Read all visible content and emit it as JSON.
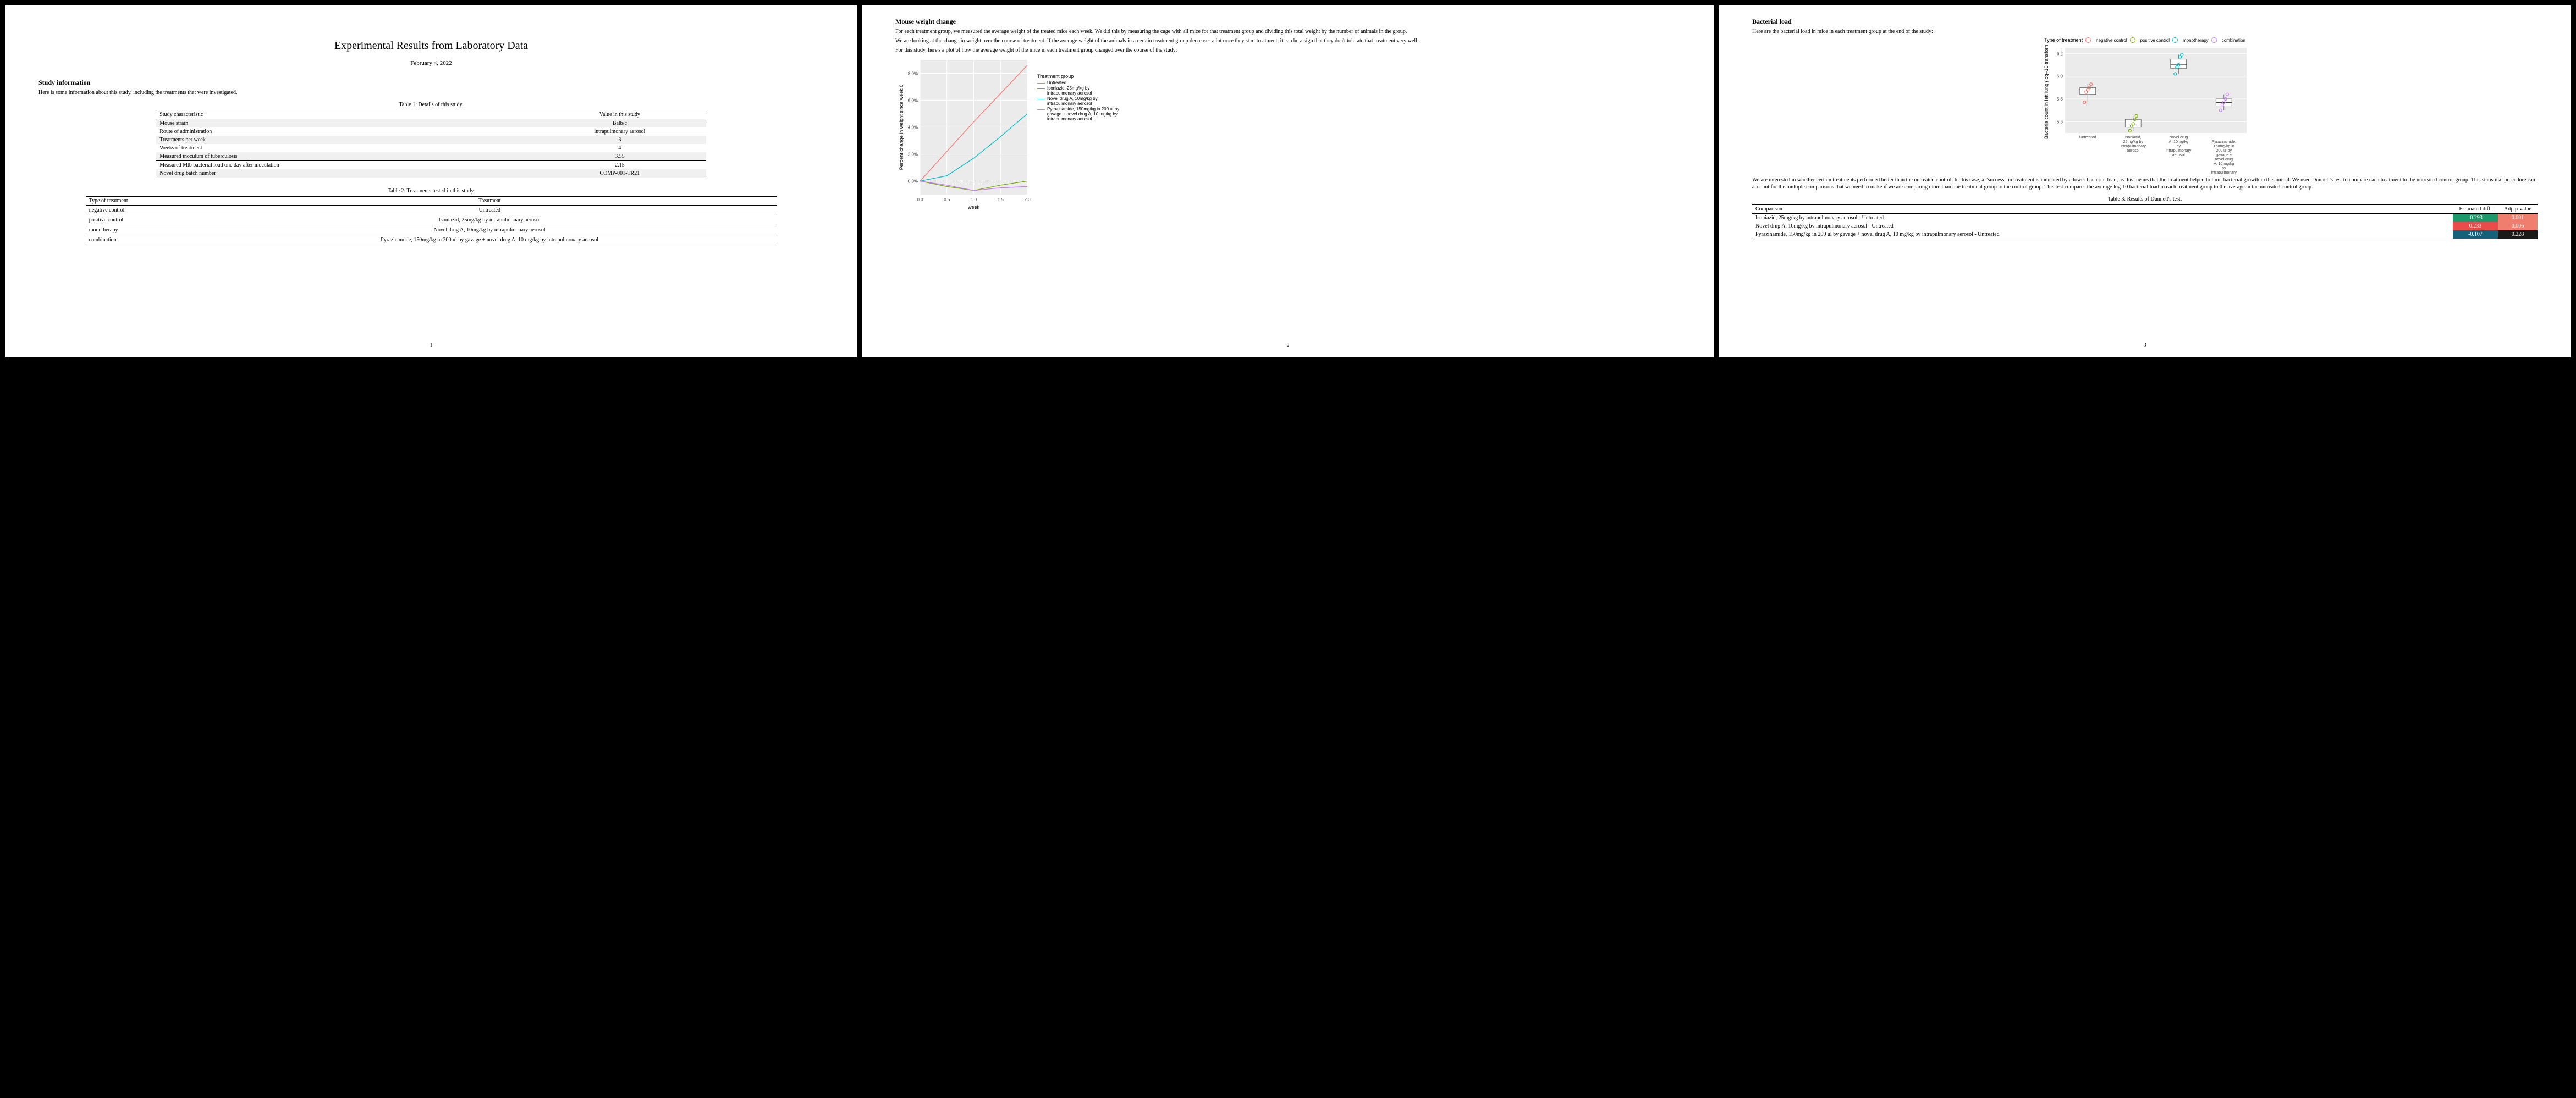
{
  "doc": {
    "title": "Experimental Results from Laboratory Data",
    "date": "February 4, 2022",
    "p1_footer": "1",
    "p2_footer": "2",
    "p3_footer": "3"
  },
  "p1": {
    "h_study": "Study information",
    "intro": "Here is some information about this study, including the treatments that were investigated.",
    "t1_caption": "Table 1: Details of this study.",
    "t1_h1": "Study characteristic",
    "t1_h2": "Value in this study",
    "t1_rows": [
      {
        "k": "Mouse strain",
        "v": "Balb/c"
      },
      {
        "k": "Route of administration",
        "v": "intrapulmonary aerosol"
      },
      {
        "k": "Treatments per week",
        "v": "3"
      },
      {
        "k": "Weeks of treatment",
        "v": "4"
      },
      {
        "k": "Measured inoculum of tuberculosis",
        "v": "3.55"
      },
      {
        "k": "Measured Mtb bacterial load one day after inoculation",
        "v": "2.15"
      },
      {
        "k": "Novel drug batch number",
        "v": "COMP-001-TR21"
      }
    ],
    "t2_caption": "Table 2: Treatments tested in this study.",
    "t2_h1": "Type of treatment",
    "t2_h2": "Treatment",
    "t2_rows": [
      {
        "k": "negative control",
        "v": "Untreated"
      },
      {
        "k": "positive control",
        "v": "Isoniazid, 25mg/kg by intrapulmonary aerosol"
      },
      {
        "k": "monotherapy",
        "v": "Novel drug A, 10mg/kg by intrapulmonary aerosol"
      },
      {
        "k": "combination",
        "v": "Pyrazinamide, 150mg/kg in 200 ul by gavage + novel drug A, 10 mg/kg by intrapulmonary aerosol"
      }
    ]
  },
  "p2": {
    "h": "Mouse weight change",
    "para1": "For each treatment group, we measured the average weight of the treated mice each week. We did this by measuring the cage with all mice for that treatment group and dividing this total weight by the number of animals in the group.",
    "para2": "We are looking at the change in weight over the course of treatment. If the average weight of the animals in a certain treatment group decreases a lot once they start treatment, it can be a sign that they don't tolerate that treatment very well.",
    "para3": "For this study, here's a plot of how the average weight of the mice in each treatment group changed over the course of the study:",
    "legend_title": "Treatment group",
    "legend_items": [
      "Untreated",
      "Isoniazid, 25mg/kg by intrapulmonary aerosol",
      "Novel drug A, 10mg/kg by intrapulmonary aerosol",
      "Pyrazinamide, 150mg/kg in 200 ul by gavage + novel drug A, 10 mg/kg by intrapulmonary aerosol"
    ],
    "ylabel": "Percent change in weight since week 0",
    "xlabel": "week"
  },
  "p3": {
    "h": "Bacterial load",
    "intro": "Here are the bacterial load in mice in each treatment group at the end of the study:",
    "type_legend_title": "Type of treatment",
    "type_legend": [
      "negative control",
      "positive control",
      "monotherapy",
      "combination"
    ],
    "ylabel": "Bacteria count in left lung (log–10 transform)",
    "box_labels": [
      "Untreated",
      "Isoniazid, 25mg/kg by intrapulmonary aerosol",
      "Novel drug A, 10mg/kg by intrapulmonary aerosol",
      "Pyrazinamide, 150mg/kg in 200 ul by gavage + novel drug A, 10 mg/kg by intrapulmonary aerosol"
    ],
    "disc": "We are interested in whether certain treatments performed better than the untreated control. In this case, a \"success\" in treatment is indicated by a lower bacterial load, as this means that the treatment helped to limit bacterial growth in the animal. We used Dunnett's test to compare each treatment to the untreated control group. This statistical procedure can account for the multiple comparisons that we need to make if we are comparing more than one treatment group to the control group. This test compares the average log-10 bacterial load in each treatment group to the average in the untreated control group.",
    "t3_caption": "Table 3: Results of Dunnett's test.",
    "t3_h1": "Comparison",
    "t3_h2": "Estimated diff.",
    "t3_h3": "Adj. p-value",
    "t3_rows": [
      {
        "c": "Isoniazid, 25mg/kg by intrapulmonary aerosol - Untreated",
        "e": "-0.293",
        "ec": "#1d9a6c",
        "p": "0.001",
        "pc": "#f07e6e"
      },
      {
        "c": "Novel drug A, 10mg/kg by intrapulmonary aerosol - Untreated",
        "e": "0.233",
        "ec": "#ea4c4c",
        "p": "0.006",
        "pc": "#f07e6e"
      },
      {
        "c": "Pyrazinamide, 150mg/kg in 200 ul by gavage + novel drug A, 10 mg/kg by intrapulmonary aerosol - Untreated",
        "e": "-0.107",
        "ec": "#13627a",
        "p": "0.228",
        "pc": "#1a1a1a"
      }
    ]
  },
  "chart_data": [
    {
      "type": "line",
      "title": "Percent change in weight since week 0",
      "xlabel": "week",
      "ylabel": "Percent change in weight since week 0",
      "x": [
        0.0,
        0.5,
        1.0,
        1.5,
        2.0
      ],
      "ylim": [
        -1,
        9
      ],
      "series": [
        {
          "name": "Untreated",
          "color": "#F8766D",
          "values": [
            0.0,
            2.2,
            4.4,
            6.5,
            8.6
          ]
        },
        {
          "name": "Isoniazid, 25mg/kg by intrapulmonary aerosol",
          "color": "#7CAE00",
          "values": [
            0.0,
            -0.4,
            -0.7,
            -0.3,
            0.0
          ]
        },
        {
          "name": "Novel drug A, 10mg/kg by intrapulmonary aerosol",
          "color": "#00BFC4",
          "values": [
            0.0,
            0.4,
            1.7,
            3.3,
            5.0
          ]
        },
        {
          "name": "Pyrazinamide, 150mg/kg in 200 ul by gavage + novel drug A, 10 mg/kg by intrapulmonary aerosol",
          "color": "#C77CFF",
          "values": [
            0.0,
            -0.3,
            -0.7,
            -0.5,
            -0.4
          ]
        }
      ]
    },
    {
      "type": "boxplot",
      "title": "Bacteria count in left lung (log-10 transform)",
      "ylabel": "Bacteria count in left lung (log–10 transform)",
      "ylim": [
        5.5,
        6.25
      ],
      "categories": [
        "Untreated",
        "Isoniazid, 25mg/kg by intrapulmonary aerosol",
        "Novel drug A, 10mg/kg by intrapulmonary aerosol",
        "Pyrazinamide, 150mg/kg in 200 ul by gavage + novel drug A, 10 mg/kg by intrapulmonary aerosol"
      ],
      "series": [
        {
          "name": "negative control",
          "color": "#F8766D",
          "box": {
            "min": 5.77,
            "q1": 5.84,
            "med": 5.87,
            "q3": 5.9,
            "max": 5.93
          },
          "points": [
            5.77,
            5.86,
            5.88,
            5.9,
            5.93
          ]
        },
        {
          "name": "positive control",
          "color": "#7CAE00",
          "box": {
            "min": 5.52,
            "q1": 5.55,
            "med": 5.58,
            "q3": 5.62,
            "max": 5.65
          },
          "points": [
            5.52,
            5.56,
            5.58,
            5.62,
            5.65
          ]
        },
        {
          "name": "monotherapy",
          "color": "#00BFC4",
          "box": {
            "min": 6.02,
            "q1": 6.07,
            "med": 6.1,
            "q3": 6.15,
            "max": 6.19
          },
          "points": [
            6.02,
            6.08,
            6.1,
            6.17,
            6.19
          ]
        },
        {
          "name": "combination",
          "color": "#C77CFF",
          "box": {
            "min": 5.7,
            "q1": 5.74,
            "med": 5.77,
            "q3": 5.8,
            "max": 5.84
          },
          "points": [
            5.7,
            5.75,
            5.77,
            5.8,
            5.84
          ]
        }
      ]
    }
  ]
}
